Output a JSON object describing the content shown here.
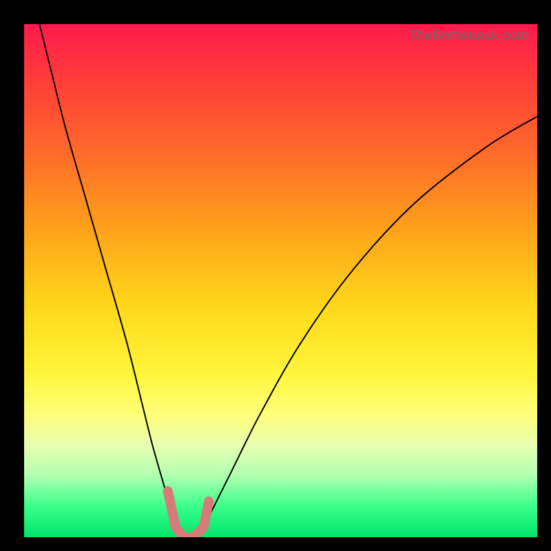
{
  "watermark": "TheBottleneck.com",
  "chart_data": {
    "type": "line",
    "title": "",
    "xlabel": "",
    "ylabel": "",
    "xlim": [
      0,
      100
    ],
    "ylim": [
      0,
      100
    ],
    "grid": false,
    "series": [
      {
        "name": "left-curve",
        "x": [
          3,
          5,
          8,
          12,
          16,
          20,
          23,
          25,
          27,
          28.5,
          29.5,
          30
        ],
        "values": [
          100,
          92,
          80,
          66,
          52,
          38,
          26,
          18,
          11,
          6,
          3,
          0
        ]
      },
      {
        "name": "right-curve",
        "x": [
          34,
          36,
          40,
          46,
          54,
          64,
          76,
          90,
          100
        ],
        "values": [
          0,
          4,
          12,
          24,
          38,
          52,
          65,
          76,
          82
        ]
      },
      {
        "name": "optimal-zone-marker",
        "x": [
          28,
          29.5,
          31,
          33,
          35,
          36
        ],
        "values": [
          9,
          2,
          0,
          0,
          2,
          7
        ]
      }
    ],
    "gradient": {
      "top": "#ff1a4d",
      "mid": "#fff53a",
      "bottom": "#00e56a"
    }
  }
}
